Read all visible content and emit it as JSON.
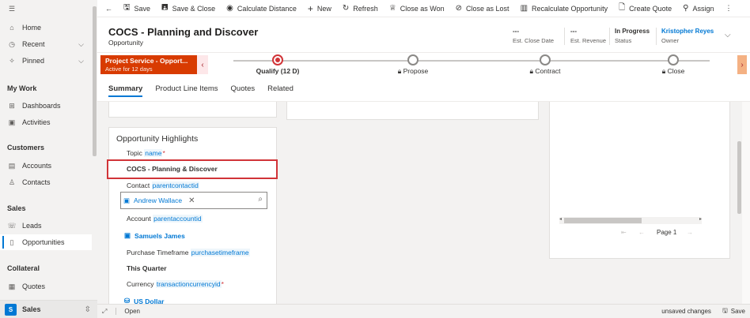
{
  "toolbar": {
    "back": "←",
    "items": [
      "Save",
      "Save & Close",
      "Calculate Distance",
      "New",
      "Refresh",
      "Close as Won",
      "Close as Lost",
      "Recalculate Opportunity",
      "Create Quote",
      "Assign"
    ],
    "more": "⋮"
  },
  "sidebar": {
    "menu": "☰",
    "home": "Home",
    "recent": "Recent",
    "pinned": "Pinned",
    "groups": [
      "My Work",
      "Customers",
      "Sales",
      "Collateral"
    ],
    "mywork": [
      "Dashboards",
      "Activities"
    ],
    "customers": [
      "Accounts",
      "Contacts"
    ],
    "sales": [
      "Leads",
      "Opportunities"
    ],
    "collateral": [
      "Quotes"
    ],
    "area_badge": "S",
    "area_label": "Sales"
  },
  "header": {
    "title": "COCS - Planning  and  Discover",
    "entity": "Opportunity",
    "close_date_value": "---",
    "close_date_label": "Est. Close Date",
    "revenue_value": "---",
    "revenue_label": "Est. Revenue",
    "status_value": "In Progress",
    "status_label": "Status",
    "owner_value": "Kristopher Reyes",
    "owner_label": "Owner"
  },
  "bpf": {
    "process_name": "Project Service - Opport...",
    "active_for": "Active for 12 days",
    "stages": [
      "Qualify  (12 D)",
      "Propose",
      "Contract",
      "Close"
    ]
  },
  "tabs": [
    "Summary",
    "Product Line Items",
    "Quotes",
    "Related"
  ],
  "form": {
    "section_title": "Opportunity Highlights",
    "topic_label": "Topic",
    "topic_schema": "name",
    "topic_value": "COCS - Planning & Discover",
    "contact_label": "Contact",
    "contact_schema": "parentcontactid",
    "contact_value": "Andrew Wallace",
    "account_label": "Account",
    "account_schema": "parentaccountid",
    "account_value": "Samuels James",
    "timeframe_label": "Purchase Timeframe",
    "timeframe_schema": "purchasetimeframe",
    "timeframe_value": "This Quarter",
    "currency_label": "Currency",
    "currency_schema": "transactioncurrencyid",
    "currency_value": "US Dollar",
    "required_mark": "*"
  },
  "grid": {
    "page_label": "Page 1"
  },
  "status": {
    "open": "Open",
    "unsaved": "unsaved changes",
    "save": "Save"
  }
}
